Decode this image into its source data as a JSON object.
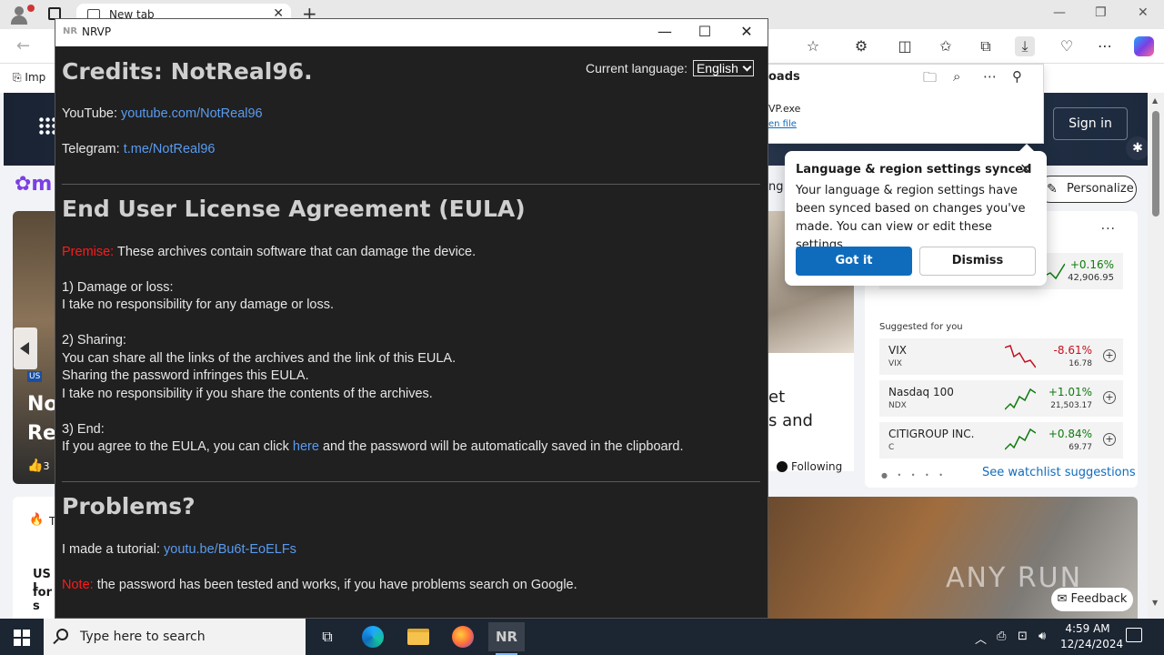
{
  "browser": {
    "tab_title": "New tab",
    "favorites_first": "Imp",
    "downloads_title": "oads",
    "download_file": "VP.exe",
    "download_open": "en file",
    "sign_in": "Sign in",
    "personalize": "Personalize",
    "following": "Following",
    "mid_text_1": "et",
    "mid_text_2": "s and",
    "left_text_1": "No",
    "left_text_2": "Re",
    "left_badge": "US",
    "left_likes": "3",
    "left_bottom_1": "US I",
    "left_bottom_2": "for s",
    "left_bottom_t": "T",
    "partial_ng": "ng",
    "feedback": "Feedback",
    "watermark": "ANY RUN"
  },
  "lang_popup": {
    "title": "Language & region settings synced",
    "message": "Your language & region settings have been synced based on changes you've made. You can view or edit these settings.",
    "got_it": "Got it",
    "dismiss": "Dismiss"
  },
  "watchlist": {
    "first": {
      "pct": "+0.16%",
      "val": "42,906.95"
    },
    "suggested_title": "Suggested for you",
    "items": [
      {
        "name": "VIX",
        "sym": "VIX",
        "pct": "-8.61%",
        "val": "16.78",
        "color": "#c50f1f"
      },
      {
        "name": "Nasdaq 100",
        "sym": "NDX",
        "pct": "+1.01%",
        "val": "21,503.17",
        "color": "#0e7a0d"
      },
      {
        "name": "CITIGROUP INC.",
        "sym": "C",
        "pct": "+0.84%",
        "val": "69.77",
        "color": "#0e7a0d"
      }
    ],
    "see_more": "See watchlist suggestions"
  },
  "nrvp": {
    "window_icon": "NR",
    "window_title": "NRVP",
    "language_label": "Current language:",
    "language_value": "English",
    "credits_title": "Credits: NotReal96.",
    "youtube_label": "YouTube:",
    "youtube_link": "youtube.com/NotReal96",
    "telegram_label": "Telegram:",
    "telegram_link": "t.me/NotReal96",
    "eula_title": "End User License Agreement (EULA)",
    "premise_label": "Premise:",
    "premise_text": "These archives contain software that can damage the device.",
    "s1_title": "1) Damage or loss:",
    "s1_text": "I take no responsibility for any damage or loss.",
    "s2_title": "2) Sharing:",
    "s2_text1": "You can share all the links of the archives and the link of this EULA.",
    "s2_text2": "Sharing the password infringes this EULA.",
    "s2_text3": "I take no responsibility if you share the contents of the archives.",
    "s3_title": "3) End:",
    "s3_pre": "If you agree to the EULA, you can click",
    "s3_link": "here",
    "s3_post": "and the password will be automatically saved in the clipboard.",
    "problems_title": "Problems?",
    "tutorial_label": "I made a tutorial:",
    "tutorial_link": "youtu.be/Bu6t-EoELFs",
    "note_label": "Note:",
    "note_text": "the password has been tested and works, if you have problems search on Google."
  },
  "taskbar": {
    "search_placeholder": "Type here to search",
    "nr_label": "NR",
    "time": "4:59 AM",
    "date": "12/24/2024"
  }
}
